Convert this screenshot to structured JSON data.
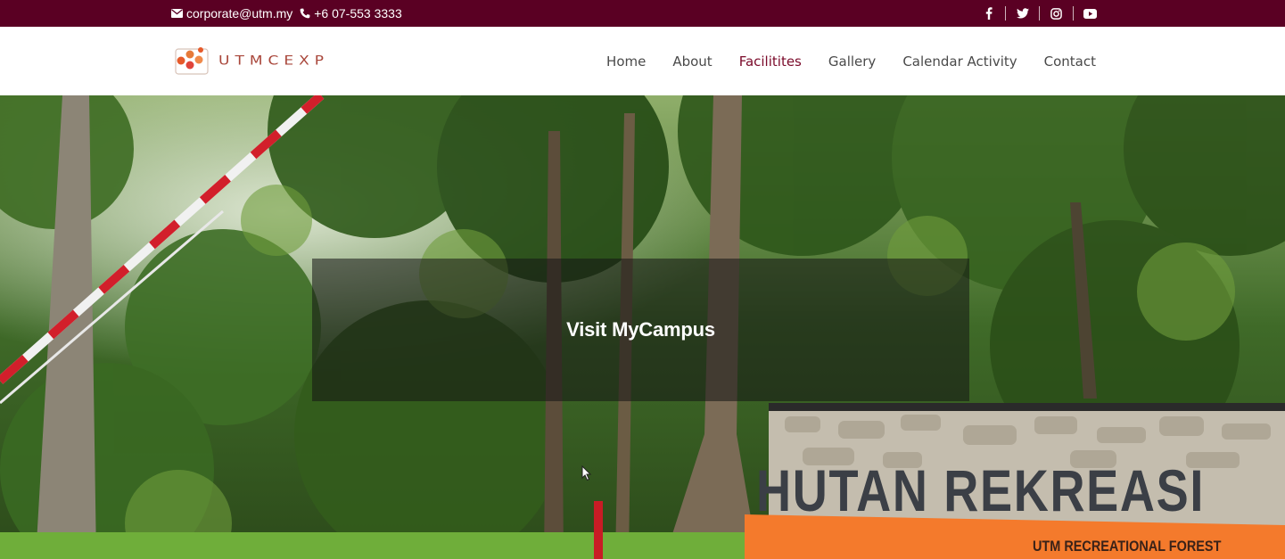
{
  "topbar": {
    "email": "corporate@utm.my",
    "phone": "+6 07-553 3333",
    "social": [
      "facebook-icon",
      "twitter-icon",
      "instagram-icon",
      "youtube-icon"
    ],
    "bg_color": "#5a0023"
  },
  "header": {
    "logo_text": "UTMCEXP",
    "nav": [
      {
        "label": "Home",
        "active": false
      },
      {
        "label": "About",
        "active": false
      },
      {
        "label": "Facilitites",
        "active": true
      },
      {
        "label": "Gallery",
        "active": false
      },
      {
        "label": "Calendar Activity",
        "active": false
      },
      {
        "label": "Contact",
        "active": false
      }
    ],
    "active_color": "#7a0a2a"
  },
  "hero": {
    "title": "Visit MyCampus",
    "sign_title": "HUTAN REKREASI",
    "sign_subtitle": "UTM RECREATIONAL FOREST"
  }
}
